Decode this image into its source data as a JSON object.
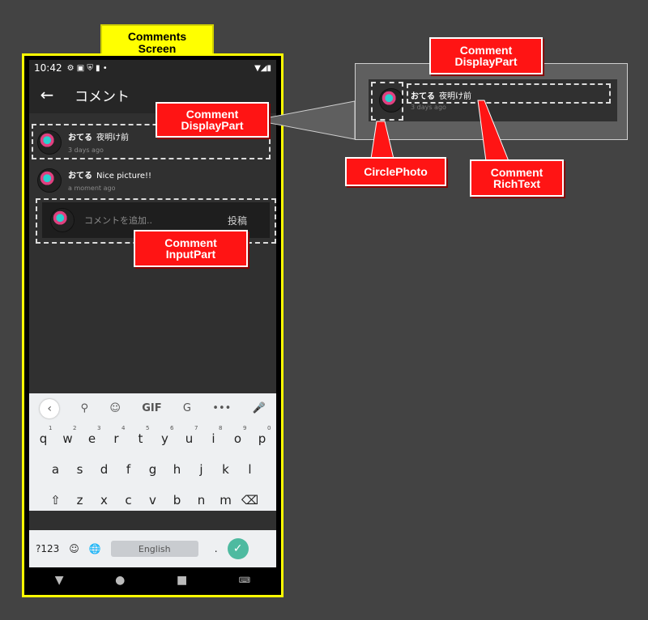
{
  "labels": {
    "comments_screen": "Comments\nScreen",
    "comment_display_part": "Comment\nDisplayPart",
    "comment_display_part_2": "Comment\nDisplayPart",
    "comment_input_part": "Comment\nInputPart",
    "circle_photo": "CirclePhoto",
    "comment_rich_text": "Comment\nRichText"
  },
  "status_bar": {
    "time": "10:42",
    "icons": "⚙ ▣ ⛨ ▮ •",
    "right_icons": "▼◢▮"
  },
  "app_bar": {
    "back_icon": "←",
    "title": "コメント"
  },
  "comments": [
    {
      "user": "おてる",
      "text": "夜明け前",
      "time": "3 days ago"
    },
    {
      "user": "おてる",
      "text": "Nice picture!!",
      "time": "a moment ago"
    }
  ],
  "input": {
    "placeholder": "コメントを追加..",
    "post_label": "投稿"
  },
  "keyboard": {
    "toolbar": {
      "back": "‹",
      "search": "⚲",
      "sticker": "☺",
      "gif": "GIF",
      "translate": "G",
      "more": "•••",
      "mic": "🎤"
    },
    "row1": [
      "q",
      "w",
      "e",
      "r",
      "t",
      "y",
      "u",
      "i",
      "o",
      "p"
    ],
    "row1_nums": [
      "1",
      "2",
      "3",
      "4",
      "5",
      "6",
      "7",
      "8",
      "9",
      "0"
    ],
    "row2": [
      "a",
      "s",
      "d",
      "f",
      "g",
      "h",
      "j",
      "k",
      "l"
    ],
    "row3": [
      "⇧",
      "z",
      "x",
      "c",
      "v",
      "b",
      "n",
      "m",
      "⌫"
    ],
    "symbols": "?123",
    "emoji": "☺",
    "globe": "🌐",
    "space": "English",
    "period": ".",
    "enter": "✓"
  },
  "nav_bar": {
    "back": "▼",
    "home": "●",
    "recents": "■",
    "keyboard": "⌨"
  },
  "zoom": {
    "user": "おてる",
    "text": "夜明け前",
    "time": "3 days ago"
  },
  "colors": {
    "label_yellow": "#ffff00",
    "label_red": "#ff1414",
    "screen_bg": "#303030"
  }
}
